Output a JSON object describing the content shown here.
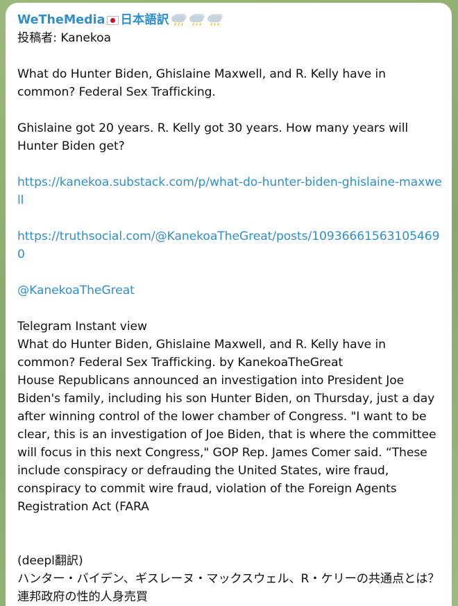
{
  "channel": {
    "name": "WeTheMedia",
    "name_suffix": "日本語訳"
  },
  "post": {
    "author_line": "投稿者: Kanekoa",
    "para1": "What do Hunter Biden, Ghislaine Maxwell, and R. Kelly have in common? Federal Sex Trafficking.",
    "para2": "Ghislaine got 20 years. R. Kelly got 30 years. How many years will Hunter Biden get?",
    "link1": "https://kanekoa.substack.com/p/what-do-hunter-biden-ghislaine-maxwell",
    "link2": "https://truthsocial.com/@KanekoaTheGreat/posts/109366615631054690",
    "mention": "@KanekoaTheGreat"
  },
  "instant_view": {
    "label": "Telegram Instant view",
    "title": "What do Hunter Biden, Ghislaine Maxwell, and R. Kelly have in common? Federal Sex Trafficking. by KanekoaTheGreat",
    "body": "House Republicans announced an investigation into President Joe Biden's family, including his son Hunter Biden, on Thursday, just a day after winning control of the lower chamber of Congress. \"I want to be clear, this is an investigation of Joe Biden, that is where the committee will focus in this next Congress,\" GOP Rep. James Comer said. “These include conspiracy or defrauding the United States, wire fraud, conspiracy to commit wire fraud, violation of the Foreign Agents Registration Act (FARA"
  },
  "translation": {
    "label": "(deepl翻訳)",
    "text": "ハンター・バイデン、ギスレーヌ・マックスウェル、R・ケリーの共通点とは？連邦政府の性的人身売買"
  },
  "icons": {
    "flag": "japan-flag-icon",
    "weather": "cloud-rain-lightning-icon"
  },
  "colors": {
    "link": "#2f8fc9",
    "channel_name": "#2f8fc9",
    "background": "#8fae74",
    "bubble": "#ffffff"
  }
}
